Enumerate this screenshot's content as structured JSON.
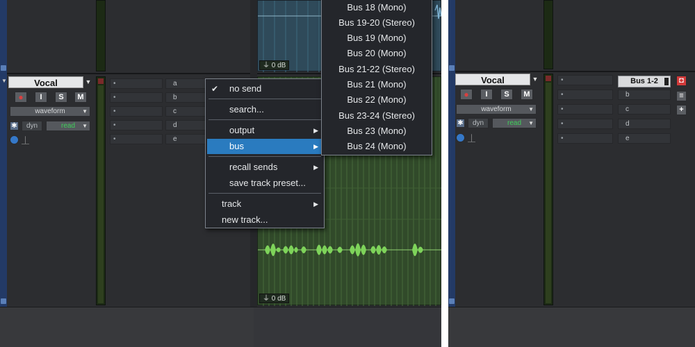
{
  "track": {
    "name": "Vocal",
    "buttons": {
      "record": "●",
      "input": "I",
      "solo": "S",
      "mute": "M"
    },
    "view": "waveform",
    "automation_mode": "read",
    "dyn": "dyn"
  },
  "sends": [
    "a",
    "b",
    "c",
    "d",
    "e"
  ],
  "clip": {
    "gain": "0 dB"
  },
  "context_menu": {
    "items": [
      {
        "label": "no send",
        "checked": true
      },
      {
        "label": "search..."
      },
      {
        "label": "output",
        "submenu": true
      },
      {
        "label": "bus",
        "submenu": true,
        "highlighted": true
      },
      {
        "label": "recall sends",
        "submenu": true
      },
      {
        "label": "save track preset..."
      },
      {
        "label": "track",
        "submenu": true
      },
      {
        "label": "new track..."
      }
    ]
  },
  "bus_menu": {
    "items": [
      "Bus 18 (Mono)",
      "Bus 19-20 (Stereo)",
      "Bus 19 (Mono)",
      "Bus 20 (Mono)",
      "Bus 21-22 (Stereo)",
      "Bus 21 (Mono)",
      "Bus 22 (Mono)",
      "Bus 23-24 (Stereo)",
      "Bus 23 (Mono)",
      "Bus 24 (Mono)"
    ]
  },
  "after": {
    "send_a_label": "Bus 1-2"
  },
  "colors": {
    "accent_blue": "#2a7bbf",
    "read_green": "#3fcf5a",
    "waveform_green": "#7ed35a"
  }
}
